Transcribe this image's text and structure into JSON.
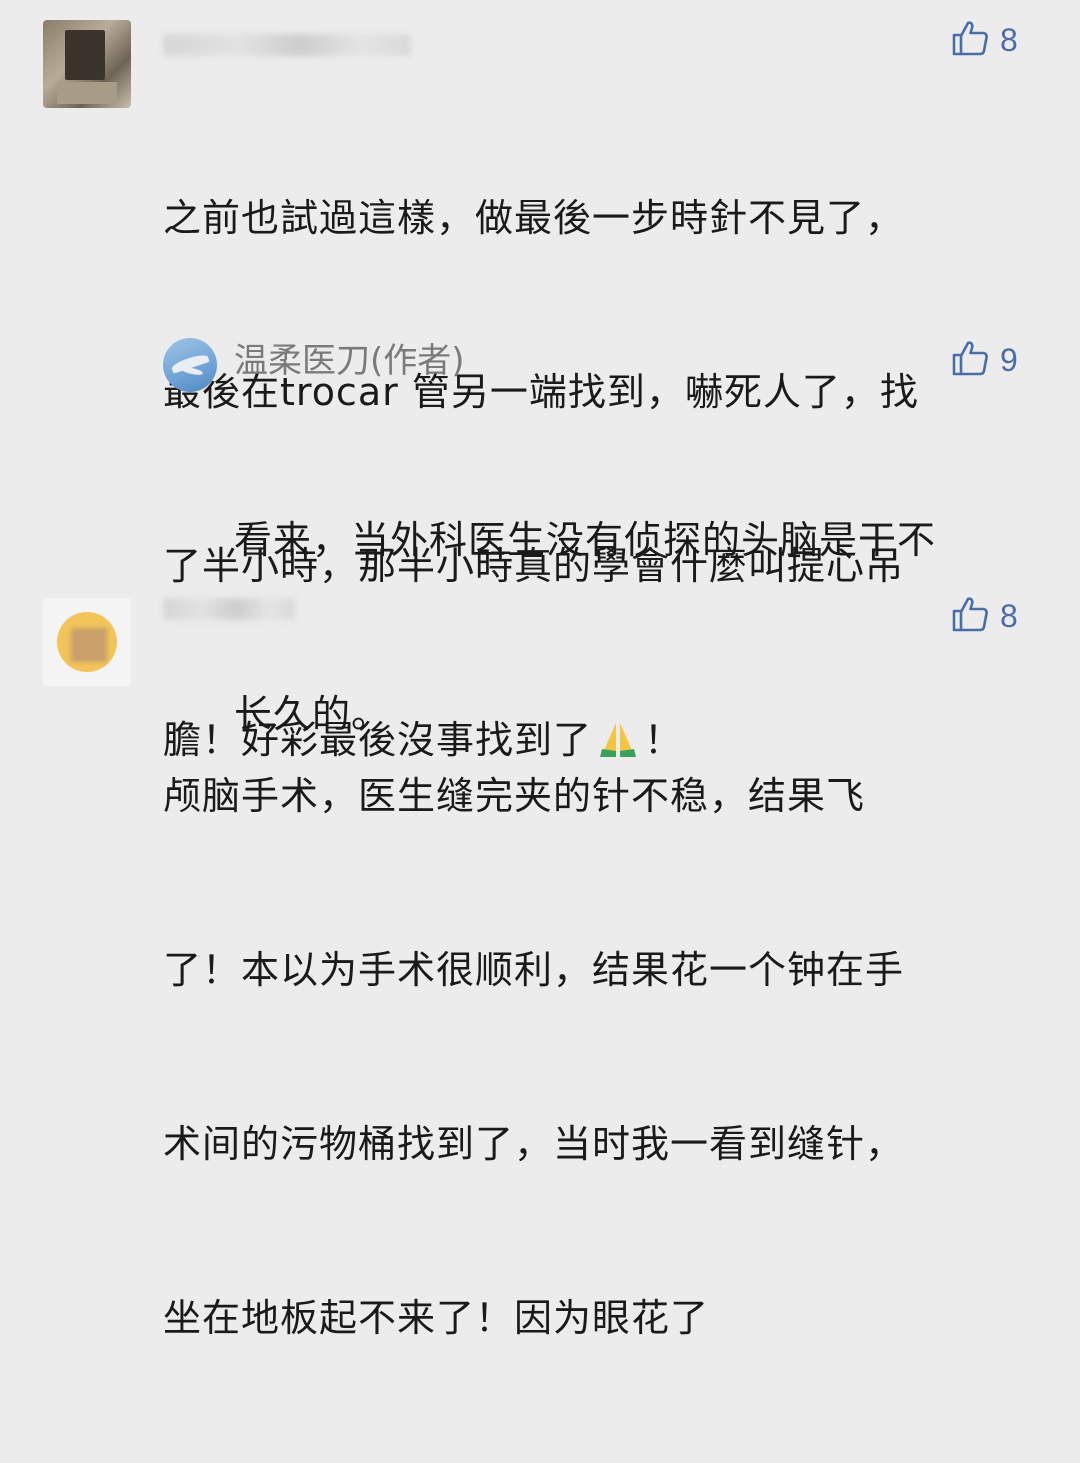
{
  "comments": [
    {
      "likes": "8",
      "lines": [
        "之前也試過這樣，做最後一步時針不見了，",
        "最後在trocar 管另一端找到，嚇死人了，找",
        "了半小時，那半小時真的學會什麼叫提心吊",
        "膽！好彩最後沒事找到了",
        "！"
      ],
      "emoji": "pray-emoji"
    },
    {
      "author": "温柔医刀(作者)",
      "likes": "9",
      "lines": [
        "看来，当外科医生没有侦探的头脑是干不",
        "长久的。"
      ]
    },
    {
      "likes": "8",
      "lines": [
        "颅脑手术，医生缝完夹的针不稳，结果飞",
        "了！本以为手术很顺利，结果花一个钟在手",
        "术间的污物桶找到了，当时我一看到缝针，",
        "坐在地板起不来了！因为眼花了"
      ]
    }
  ],
  "icons": {
    "like": "thumbs-up-icon",
    "like_color": "#4a6da8"
  }
}
